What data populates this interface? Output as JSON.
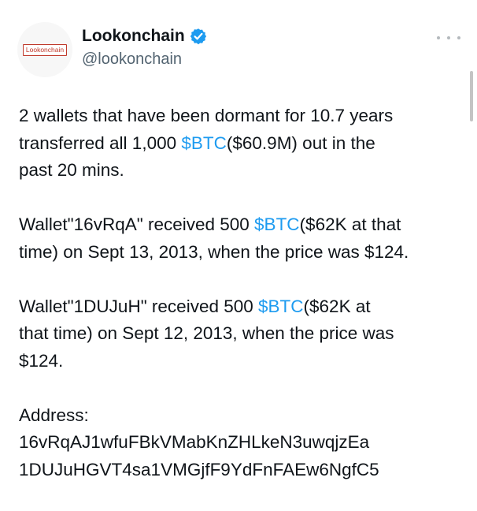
{
  "author": {
    "display_name": "Lookonchain",
    "handle": "@lookonchain",
    "avatar_text": "Lookonchain",
    "verified_icon": "verified-badge-icon",
    "more_icon": "more-options-icon"
  },
  "colors": {
    "link": "#1d9bf0",
    "text": "#0f1419",
    "secondary": "#536471",
    "verified": "#1d9bf0",
    "avatar_border": "#c0392b"
  },
  "tweet": {
    "p1": {
      "line1": "2 wallets that have been dormant for 10.7 years",
      "line2_a": "transferred all 1,000 ",
      "line2_tag": "$BTC",
      "line2_b": "($60.9M) out in the",
      "line3": "past 20 mins."
    },
    "p2": {
      "line1_a": "Wallet\"16vRqA\" received 500 ",
      "line1_tag": "$BTC",
      "line1_b": "($62K at that",
      "line2": "time) on Sept 13, 2013, when the price was $124."
    },
    "p3": {
      "line1_a": "Wallet\"1DUJuH\" received 500 ",
      "line1_tag": "$BTC",
      "line1_b": "($62K at",
      "line2": "that time) on Sept 12, 2013, when the price was",
      "line3": "$124."
    },
    "p4": {
      "label": "Address:",
      "address1": "16vRqAJ1wfuFBkVMabKnZHLkeN3uwqjzEa",
      "address2": "1DUJuHGVT4sa1VMGjfF9YdFnFAEw6NgfC5"
    }
  }
}
